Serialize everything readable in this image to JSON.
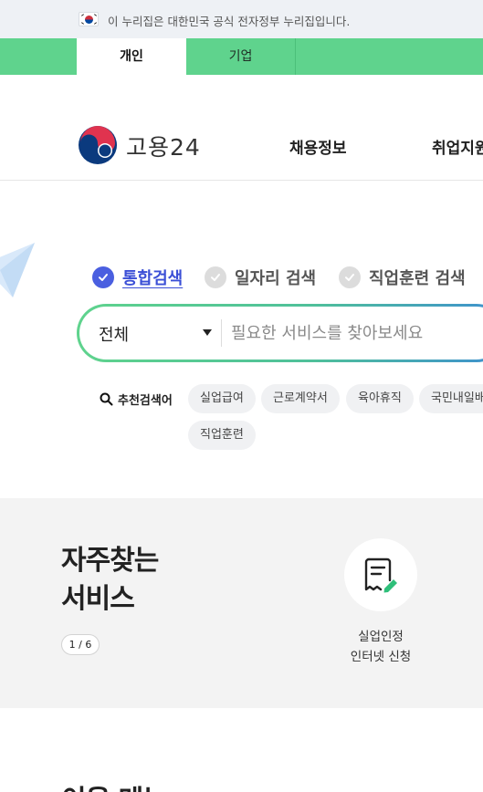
{
  "gov_banner": {
    "text": "이 누리집은 대한민국 공식 전자정부 누리집입니다."
  },
  "user_tabs": [
    {
      "label": "개인",
      "active": true
    },
    {
      "label": "기업",
      "active": false
    }
  ],
  "header": {
    "logo_text": "고용24",
    "nav": [
      "채용정보",
      "취업지원"
    ]
  },
  "search": {
    "scopes": [
      {
        "label": "통합검색",
        "selected": true
      },
      {
        "label": "일자리 검색",
        "selected": false
      },
      {
        "label": "직업훈련 검색",
        "selected": false
      }
    ],
    "category_value": "전체",
    "placeholder": "필요한 서비스를 찾아보세요",
    "recommended_label": "추천검색어",
    "recommended_keywords": [
      "실업급여",
      "근로계약서",
      "육아휴직",
      "국민내일배움카드",
      "직업훈련"
    ]
  },
  "frequent": {
    "title_line1": "자주찾는",
    "title_line2": "서비스",
    "pager": "1 / 6",
    "items": [
      {
        "label_line1": "실업인정",
        "label_line2": "인터넷 신청",
        "icon": "document-edit-icon"
      }
    ]
  },
  "bottom_heading": "이용 메뉴",
  "colors": {
    "tab_bar": "#5fd38d",
    "accent_blue": "#3b4fd6",
    "chip_bg": "#f0f1f3",
    "section_bg": "#f3f3f3"
  }
}
